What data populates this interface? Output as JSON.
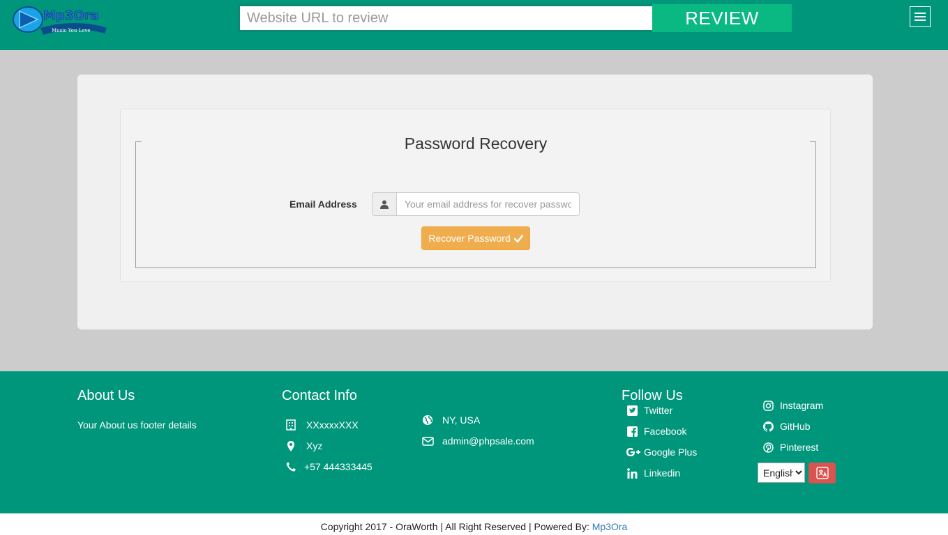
{
  "header": {
    "search_placeholder": "Website URL to review",
    "review_label": "REVIEW"
  },
  "recovery": {
    "title": "Password Recovery",
    "email_label": "Email Address",
    "email_placeholder": "Your email address for recover password",
    "button_label": "Recover Password"
  },
  "footer": {
    "about": {
      "title": "About Us",
      "text": "Your About us footer details"
    },
    "contact": {
      "title": "Contact Info",
      "company": "XXxxxxXXX",
      "address": "Xyz",
      "phone": "+57 444333445",
      "location": "NY, USA",
      "email": "admin@phpsale.com"
    },
    "follow": {
      "title": "Follow Us",
      "twitter": "Twitter",
      "facebook": "Facebook",
      "google_plus": "Google Plus",
      "linkedin": "Linkedin",
      "instagram": "Instagram",
      "github": "GitHub",
      "pinterest": "Pinterest"
    },
    "language": {
      "selected": "English"
    }
  },
  "copyright": {
    "text": "Copyright 2017 - OraWorth | All Right Reserved | Powered By: ",
    "link": "Mp3Ora"
  },
  "colors": {
    "header_bg": "#00967c",
    "review_btn": "#0ab882",
    "recover_btn": "#f0ad4e",
    "translate_btn": "#d9534f"
  }
}
